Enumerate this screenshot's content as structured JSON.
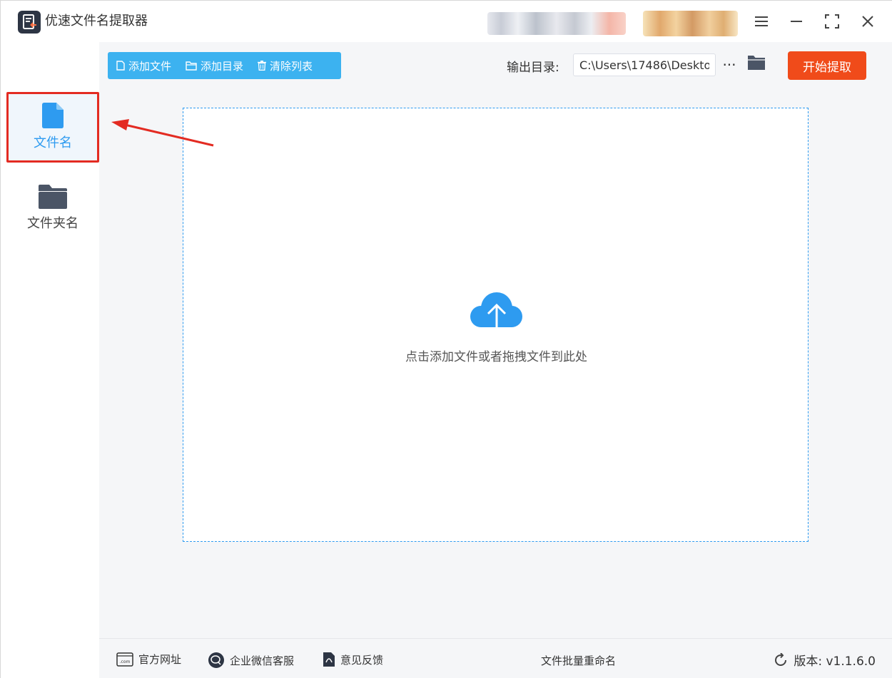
{
  "app": {
    "title": "优速文件名提取器"
  },
  "window_controls": {
    "menu_icon": "hamburger-icon",
    "minimize_icon": "minimize-icon",
    "maximize_icon": "maximize-icon",
    "close_icon": "close-icon"
  },
  "sidebar": {
    "items": [
      {
        "label": "文件名",
        "icon": "file-icon",
        "active": true
      },
      {
        "label": "文件夹名",
        "icon": "folder-icon",
        "active": false
      }
    ]
  },
  "toolbar": {
    "add_file": "添加文件",
    "add_dir": "添加目录",
    "clear_list": "清除列表",
    "output_label": "输出目录:",
    "output_value": "C:\\Users\\17486\\Deskto",
    "more": "···",
    "start": "开始提取"
  },
  "dropzone": {
    "hint": "点击添加文件或者拖拽文件到此处"
  },
  "footer": {
    "website": "官方网址",
    "wechat": "企业微信客服",
    "feedback": "意见反馈",
    "center": "文件批量重命名",
    "version": "版本:  v1.1.6.0"
  },
  "colors": {
    "accent": "#3cb2f0",
    "primary_blue": "#2e9bf0",
    "start_button": "#f04b1a",
    "highlight": "#e32b22"
  }
}
